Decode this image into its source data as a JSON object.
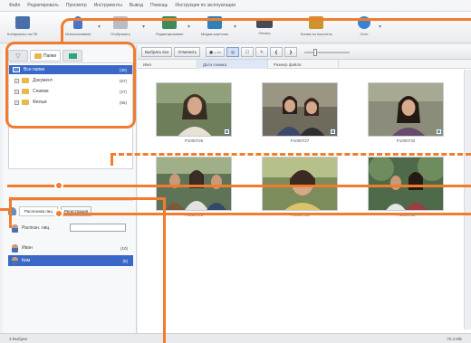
{
  "menu": [
    "Файл",
    "Редактировать",
    "Просмотр",
    "Инструменты",
    "Вывод",
    "Помощь",
    "Инструкция по эксплуатации"
  ],
  "toolbar": [
    {
      "label": "Копировать на ПК",
      "icon": "import-icon",
      "color": "#4a6fa8"
    },
    {
      "label": "Использование",
      "icon": "person-icon",
      "color": "#4a74c9"
    },
    {
      "label": "Отобразить",
      "icon": "print-icon",
      "color": "#8a8f99"
    },
    {
      "label": "Редактирование",
      "icon": "edit-icon",
      "color": "#3f8a58"
    },
    {
      "label": "Медиа-карточка",
      "icon": "media-icon",
      "color": "#2f7fb8"
    },
    {
      "label": "Печать",
      "icon": "printer-icon",
      "color": "#444b55"
    },
    {
      "label": "Копия на носитель",
      "icon": "disc-icon",
      "color": "#c9952c"
    },
    {
      "label": "Сеть",
      "icon": "globe-icon",
      "color": "#3a82d0"
    }
  ],
  "tabs": [
    {
      "label": "",
      "icon": "filter-icon"
    },
    {
      "label": "Папки",
      "icon": "folder-icon"
    },
    {
      "label": "",
      "icon": "card-icon"
    }
  ],
  "folder_tree": [
    {
      "label": "Все папки",
      "count": "(30)",
      "selected": true,
      "type": "all"
    },
    {
      "label": "Документ",
      "count": "(67)",
      "selected": false,
      "type": "folder"
    },
    {
      "label": "Снимки",
      "count": "(27)",
      "selected": false,
      "type": "folder"
    },
    {
      "label": "Фильм",
      "count": "(55)",
      "selected": false,
      "type": "folder"
    }
  ],
  "people_panel": {
    "tab_label": "Распознав.лиц",
    "button_label": "Регистрация"
  },
  "people": [
    {
      "label": "Распозн. лиц",
      "count": "",
      "selected": false
    },
    {
      "label": "Иван",
      "count": "(10)",
      "selected": false
    },
    {
      "label": "Ким",
      "count": "(5)",
      "selected": true
    }
  ],
  "view_toolbar": [
    {
      "label": "Выбрать все",
      "active": false
    },
    {
      "label": "Отменить",
      "active": false
    },
    {
      "label": "▣↔▭",
      "active": false
    },
    {
      "label": "◎",
      "active": true
    },
    {
      "label": "☐",
      "active": false
    },
    {
      "label": "✎",
      "active": false
    },
    {
      "label": "❮",
      "active": false
    },
    {
      "label": "❯",
      "active": false
    }
  ],
  "columns": [
    {
      "label": "Имя",
      "sorted": false
    },
    {
      "label": "Дата снимка",
      "sorted": true
    },
    {
      "label": "Размер файла",
      "sorted": false
    }
  ],
  "thumbnails": [
    {
      "caption": "P1000725",
      "scene": "woman-portrait"
    },
    {
      "caption": "P1000727",
      "scene": "two-women"
    },
    {
      "caption": "P1000732",
      "scene": "woman-smile"
    },
    {
      "caption": "P1000728",
      "scene": "group-outdoor"
    },
    {
      "caption": "P1000734",
      "scene": "child-portrait"
    },
    {
      "caption": "P1000735",
      "scene": "group-trees"
    }
  ],
  "status": {
    "left": "3 Выбран",
    "right": "75.3 МБ"
  },
  "colors": {
    "accent_orange": "#f27c2e",
    "selection_blue": "#3a68c8",
    "folder_yellow": "#e8b84a"
  }
}
